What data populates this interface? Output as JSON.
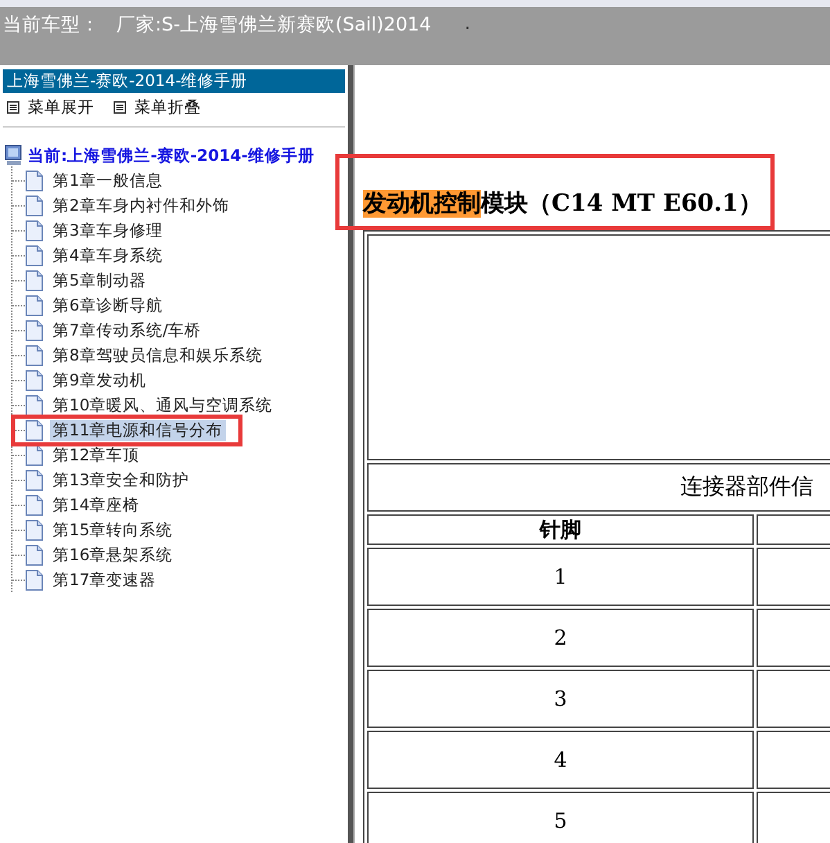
{
  "top_bar": {
    "label": "当前车型：",
    "value": "厂家:S-上海雪佛兰新赛欧(Sail)2014",
    "trailing": "."
  },
  "sidebar": {
    "title": "上海雪佛兰-赛欧-2014-维修手册",
    "menu_buttons": [
      "菜单展开",
      "菜单折叠"
    ],
    "tree": {
      "label": "当前:上海雪佛兰-赛欧-2014-维修手册",
      "children": [
        {
          "label": "第1章一般信息",
          "selected": false
        },
        {
          "label": "第2章车身内衬件和外饰",
          "selected": false
        },
        {
          "label": "第3章车身修理",
          "selected": false
        },
        {
          "label": "第4章车身系统",
          "selected": false
        },
        {
          "label": "第5章制动器",
          "selected": false
        },
        {
          "label": "第6章诊断导航",
          "selected": false
        },
        {
          "label": "第7章传动系统/车桥",
          "selected": false
        },
        {
          "label": "第8章驾驶员信息和娱乐系统",
          "selected": false
        },
        {
          "label": "第9章发动机",
          "selected": false
        },
        {
          "label": "第10章暖风、通风与空调系统",
          "selected": false
        },
        {
          "label": "第11章电源和信号分布",
          "selected": true
        },
        {
          "label": "第12章车顶",
          "selected": false
        },
        {
          "label": "第13章安全和防护",
          "selected": false
        },
        {
          "label": "第14章座椅",
          "selected": false
        },
        {
          "label": "第15章转向系统",
          "selected": false
        },
        {
          "label": "第16章悬架系统",
          "selected": false
        },
        {
          "label": "第17章变速器",
          "selected": false
        }
      ]
    }
  },
  "document": {
    "heading_parts": [
      {
        "text": "发动机控制",
        "highlighted": true
      },
      {
        "text": "模块（C14 MT E60.1）",
        "highlighted": false
      }
    ],
    "table": {
      "caption": "连接器部件信",
      "columns": [
        "针脚"
      ],
      "rows": [
        [
          "1"
        ],
        [
          "2"
        ],
        [
          "3"
        ],
        [
          "4"
        ],
        [
          "5"
        ]
      ]
    }
  }
}
